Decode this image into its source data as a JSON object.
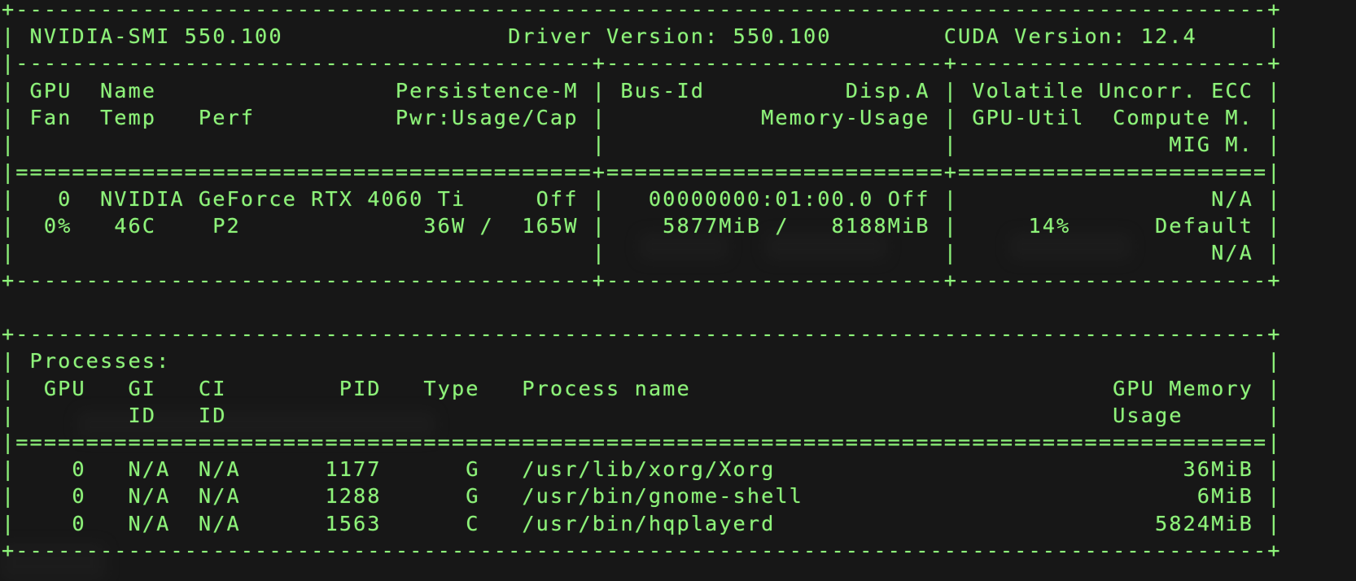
{
  "terminal": {
    "text_color": "#8ef37a",
    "background_color": "#171717",
    "lines": [
      "+-----------------------------------------------------------------------------------------+",
      "| NVIDIA-SMI 550.100                Driver Version: 550.100        CUDA Version: 12.4     |",
      "|-----------------------------------------+------------------------+----------------------+",
      "| GPU  Name                 Persistence-M | Bus-Id          Disp.A | Volatile Uncorr. ECC |",
      "| Fan  Temp   Perf          Pwr:Usage/Cap |           Memory-Usage | GPU-Util  Compute M. |",
      "|                                         |                        |               MIG M. |",
      "|=========================================+========================+======================|",
      "|   0  NVIDIA GeForce RTX 4060 Ti     Off |   00000000:01:00.0 Off |                  N/A |",
      "|  0%   46C    P2             36W /  165W |    5877MiB /   8188MiB |     14%      Default |",
      "|                                         |                        |                  N/A |",
      "+-----------------------------------------+------------------------+----------------------+",
      "",
      "+-----------------------------------------------------------------------------------------+",
      "| Processes:                                                                              |",
      "|  GPU   GI   CI        PID   Type   Process name                              GPU Memory |",
      "|        ID   ID                                                               Usage      |",
      "|=========================================================================================|",
      "|    0   N/A  N/A      1177      G   /usr/lib/xorg/Xorg                             36MiB |",
      "|    0   N/A  N/A      1288      G   /usr/bin/gnome-shell                            6MiB |",
      "|    0   N/A  N/A      1563      C   /usr/bin/hqplayerd                           5824MiB |",
      "+-----------------------------------------------------------------------------------------+"
    ]
  }
}
